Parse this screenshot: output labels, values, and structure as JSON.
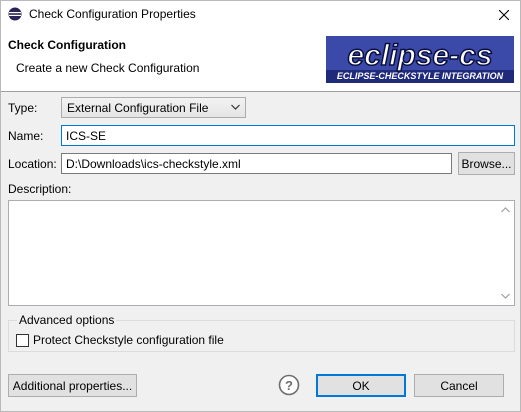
{
  "window": {
    "title": "Check Configuration Properties"
  },
  "header": {
    "title": "Check Configuration",
    "subtitle": "Create a new Check Configuration",
    "logo_main": "eclipse-cs",
    "logo_sub": "ECLIPSE-CHECKSTYLE INTEGRATION"
  },
  "form": {
    "type_label": "Type:",
    "type_value": "External Configuration File",
    "name_label": "Name:",
    "name_value": "ICS-SE",
    "location_label": "Location:",
    "location_value": "D:\\Downloads\\ics-checkstyle.xml",
    "browse_label": "Browse...",
    "description_label": "Description:",
    "description_value": ""
  },
  "advanced": {
    "legend": "Advanced options",
    "protect_label": "Protect Checkstyle configuration file",
    "protect_checked": false
  },
  "footer": {
    "additional_label": "Additional properties...",
    "ok_label": "OK",
    "cancel_label": "Cancel"
  }
}
